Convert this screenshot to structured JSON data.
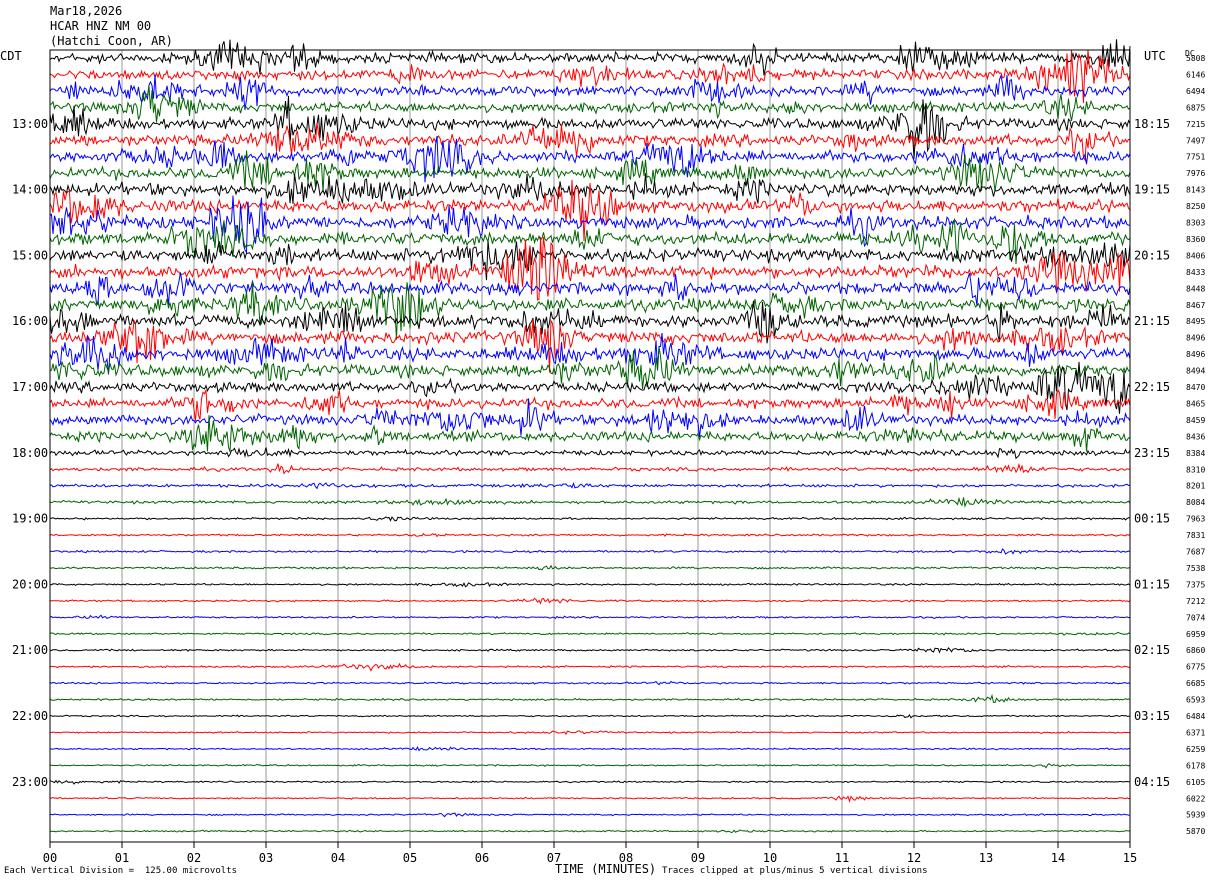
{
  "header": {
    "date": "Mar18,2026",
    "station": "HCAR HNZ NM 00",
    "location": "(Hatchi Coon, AR)"
  },
  "left_tz": "CDT",
  "right_tz": "UTC",
  "dc_label": "DC",
  "footer": {
    "scale": "Each Vertical Division =  125.00 microvolts",
    "clip": "Traces clipped at plus/minus 5 vertical divisions"
  },
  "chart_data": {
    "type": "line",
    "title": "",
    "xlabel": "TIME (MINUTES)",
    "ylabel": "",
    "xlim": [
      0,
      15
    ],
    "x_ticks": [
      "00",
      "01",
      "02",
      "03",
      "04",
      "05",
      "06",
      "07",
      "08",
      "09",
      "10",
      "11",
      "12",
      "13",
      "14",
      "15"
    ],
    "left_hour_labels": [
      "13:00",
      "14:00",
      "15:00",
      "16:00",
      "17:00",
      "18:00",
      "19:00",
      "20:00",
      "21:00",
      "22:00",
      "23:00"
    ],
    "right_hour_labels": [
      "18:15",
      "19:15",
      "20:15",
      "21:15",
      "22:15",
      "23:15",
      "00:15",
      "01:15",
      "02:15",
      "03:15",
      "04:15"
    ],
    "trace_colors": [
      "#000000",
      "#ff0000",
      "#0000ff",
      "#006400"
    ],
    "dc_offsets": [
      5808,
      6146,
      6494,
      6875,
      7215,
      7497,
      7751,
      7976,
      8143,
      8250,
      8303,
      8360,
      8406,
      8433,
      8448,
      8467,
      8495,
      8496,
      8496,
      8494,
      8470,
      8465,
      8459,
      8436,
      8384,
      8310,
      8201,
      8084,
      7963,
      7831,
      7687,
      7538,
      7375,
      7212,
      7074,
      6959,
      6860,
      6775,
      6685,
      6593,
      6484,
      6371,
      6259,
      6178,
      6105,
      6022,
      5939,
      5870
    ],
    "trace_noise_level": [
      4,
      4,
      4,
      4,
      4.5,
      4.5,
      4.5,
      4.5,
      5,
      5,
      5,
      5,
      5,
      5,
      5,
      5,
      5,
      5,
      5,
      5,
      4,
      4,
      4,
      4,
      2,
      1.4,
      1.2,
      1.1,
      0.8,
      0.8,
      0.8,
      0.8,
      0.7,
      0.7,
      0.7,
      0.7,
      0.7,
      0.7,
      0.7,
      0.7,
      0.6,
      0.6,
      0.6,
      0.6,
      0.6,
      0.6,
      0.6,
      0.6
    ]
  }
}
